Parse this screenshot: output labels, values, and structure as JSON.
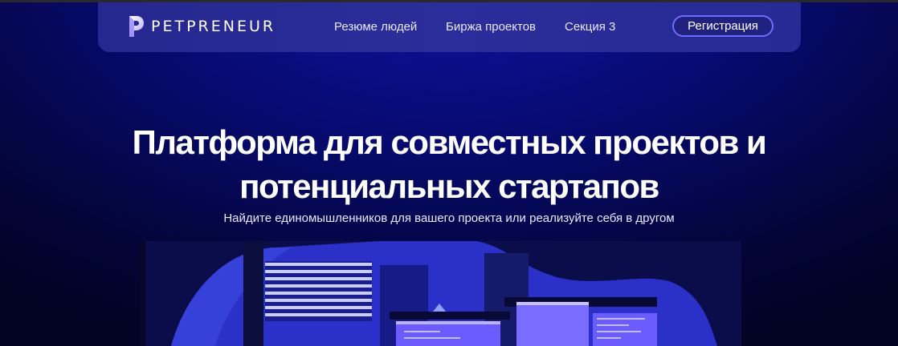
{
  "brand": {
    "name": "PETPRENEUR"
  },
  "nav": {
    "links": [
      "Резюме людей",
      "Биржа проектов",
      "Секция 3"
    ],
    "register_label": "Регистрация"
  },
  "hero": {
    "title_line1": "Платформа для совместных проектов и",
    "title_line2": "потенциальных стартапов",
    "subtitle": "Найдите единомышленников для вашего проекта или реализуйте себя в другом"
  },
  "colors": {
    "background": "#070a6e",
    "navbar": "#2b2d9a",
    "accent": "#6f6bff"
  }
}
